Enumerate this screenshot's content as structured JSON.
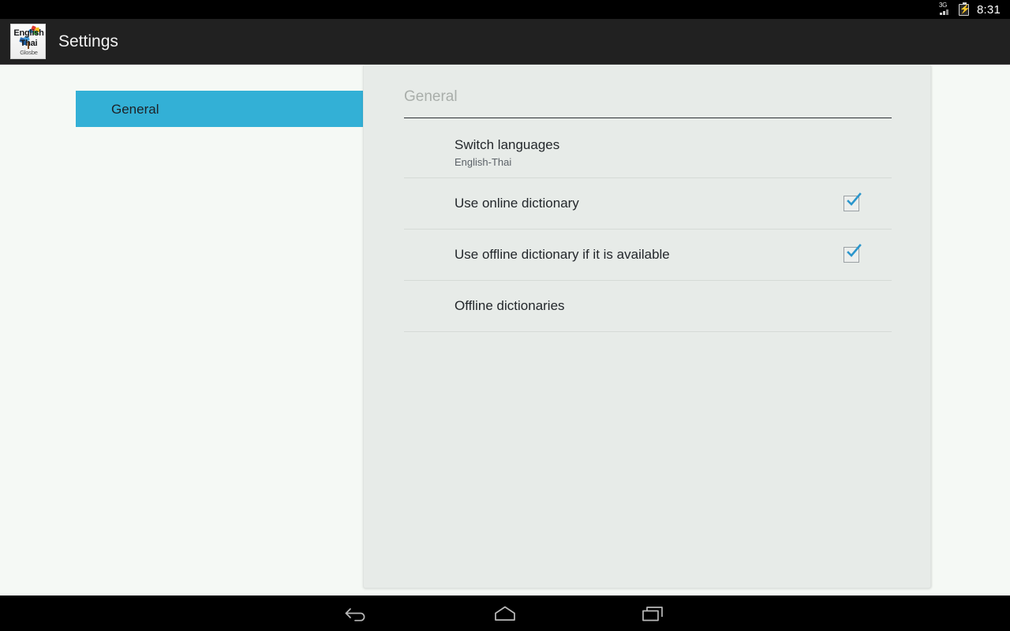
{
  "status_bar": {
    "network_label": "3G",
    "clock": "8:31",
    "icons": [
      "signal-icon",
      "battery-charging-icon"
    ]
  },
  "action_bar": {
    "title": "Settings",
    "app_icon": {
      "name": "app-icon",
      "line1": "English",
      "line2": "Thai",
      "line3": "Glosbe"
    }
  },
  "sidebar": {
    "items": [
      {
        "label": "General",
        "selected": true
      }
    ],
    "selected_color": "#33b0d6"
  },
  "preferences": {
    "header": "General",
    "rows": [
      {
        "title": "Switch languages",
        "summary": "English-Thai",
        "has_checkbox": false,
        "checked": false
      },
      {
        "title": "Use online dictionary",
        "summary": "",
        "has_checkbox": true,
        "checked": true
      },
      {
        "title": "Use offline dictionary if it is available",
        "summary": "",
        "has_checkbox": true,
        "checked": true
      },
      {
        "title": "Offline dictionaries",
        "summary": "",
        "has_checkbox": false,
        "checked": false
      }
    ],
    "checkbox_color": "#2b96cc",
    "panel_background": "#e7ebe8"
  },
  "nav_bar": {
    "buttons": [
      {
        "name": "back-icon"
      },
      {
        "name": "home-icon"
      },
      {
        "name": "recents-icon"
      }
    ]
  }
}
